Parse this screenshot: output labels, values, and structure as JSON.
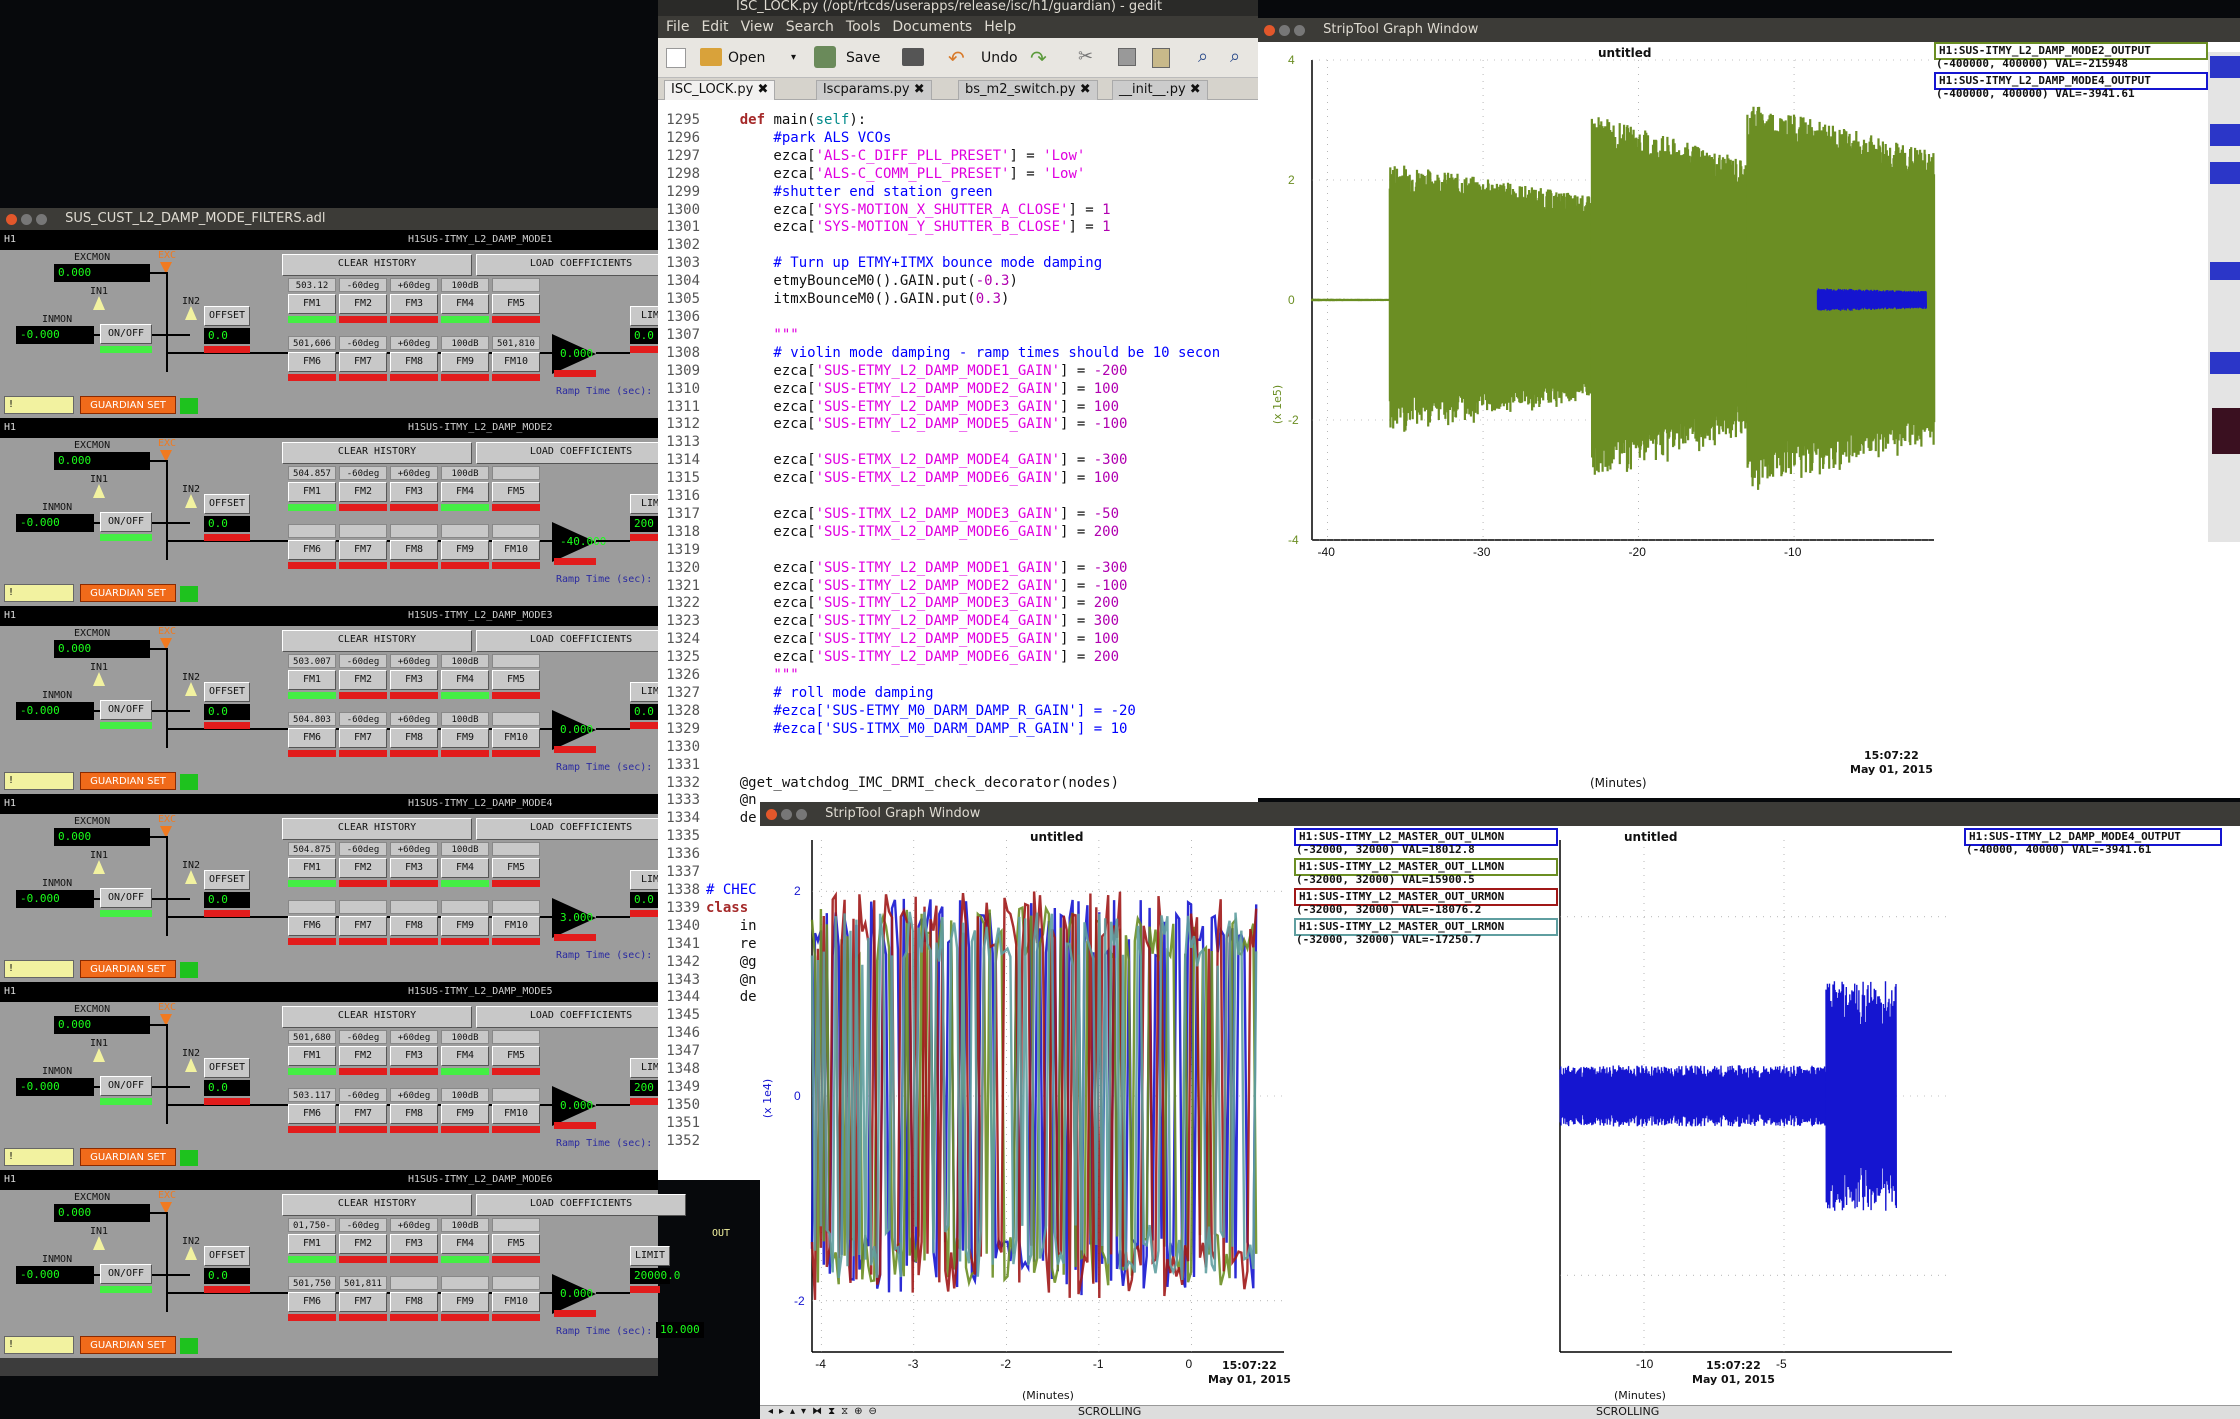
{
  "medm": {
    "title": "SUS_CUST_L2_DAMP_MODE_FILTERS.adl",
    "banks": [
      {
        "prefix": "H1",
        "name": "H1SUS-ITMY_L2_DAMP_MODE1",
        "excmon": "0.000",
        "inmon": "-0.000",
        "clear": "CLEAR HISTORY",
        "load": "LOAD COEFFICIENTS",
        "offset": "OFFSET",
        "offset_val": "0.0",
        "fm_top": [
          "FM1",
          "FM2",
          "FM3",
          "FM4",
          "FM5"
        ],
        "fm_bot": [
          "FM6",
          "FM7",
          "FM8",
          "FM9",
          "FM10"
        ],
        "vals_top": [
          "503.12",
          "-60deg",
          "+60deg",
          "100dB",
          ""
        ],
        "vals_bot": [
          "501,606",
          "-60deg",
          "+60deg",
          "100dB",
          "501,810"
        ],
        "out": "0.000",
        "limit_val": "0.0",
        "ramp": "Ramp Time (sec):",
        "onoff": "ON/OFF",
        "guardian": "GUARDIAN SET",
        "exc": "EXC",
        "in1": "IN1",
        "in2": "IN2",
        "limit": "LIM",
        "excmon_lbl": "EXCMON",
        "inmon_lbl": "INMON"
      },
      {
        "prefix": "H1",
        "name": "H1SUS-ITMY_L2_DAMP_MODE2",
        "excmon": "0.000",
        "inmon": "-0.000",
        "clear": "CLEAR HISTORY",
        "load": "LOAD COEFFICIENTS",
        "offset": "OFFSET",
        "offset_val": "0.0",
        "fm_top": [
          "FM1",
          "FM2",
          "FM3",
          "FM4",
          "FM5"
        ],
        "fm_bot": [
          "FM6",
          "FM7",
          "FM8",
          "FM9",
          "FM10"
        ],
        "vals_top": [
          "504.857",
          "-60deg",
          "+60deg",
          "100dB",
          ""
        ],
        "vals_bot": [
          "",
          "",
          "",
          "",
          ""
        ],
        "out": "-40.000",
        "limit_val": "200",
        "ramp": "Ramp Time (sec):",
        "onoff": "ON/OFF",
        "guardian": "GUARDIAN SET",
        "exc": "EXC",
        "in1": "IN1",
        "in2": "IN2",
        "limit": "LIM",
        "excmon_lbl": "EXCMON",
        "inmon_lbl": "INMON"
      },
      {
        "prefix": "H1",
        "name": "H1SUS-ITMY_L2_DAMP_MODE3",
        "excmon": "0.000",
        "inmon": "-0.000",
        "clear": "CLEAR HISTORY",
        "load": "LOAD COEFFICIENTS",
        "offset": "OFFSET",
        "offset_val": "0.0",
        "fm_top": [
          "FM1",
          "FM2",
          "FM3",
          "FM4",
          "FM5"
        ],
        "fm_bot": [
          "FM6",
          "FM7",
          "FM8",
          "FM9",
          "FM10"
        ],
        "vals_top": [
          "503.007",
          "-60deg",
          "+60deg",
          "100dB",
          ""
        ],
        "vals_bot": [
          "504.803",
          "-60deg",
          "+60deg",
          "100dB",
          ""
        ],
        "out": "0.000",
        "limit_val": "0.0",
        "ramp": "Ramp Time (sec):",
        "onoff": "ON/OFF",
        "guardian": "GUARDIAN SET",
        "exc": "EXC",
        "in1": "IN1",
        "in2": "IN2",
        "limit": "LIM",
        "excmon_lbl": "EXCMON",
        "inmon_lbl": "INMON"
      },
      {
        "prefix": "H1",
        "name": "H1SUS-ITMY_L2_DAMP_MODE4",
        "excmon": "0.000",
        "inmon": "-0.000",
        "clear": "CLEAR HISTORY",
        "load": "LOAD COEFFICIENTS",
        "offset": "OFFSET",
        "offset_val": "0.0",
        "fm_top": [
          "FM1",
          "FM2",
          "FM3",
          "FM4",
          "FM5"
        ],
        "fm_bot": [
          "FM6",
          "FM7",
          "FM8",
          "FM9",
          "FM10"
        ],
        "vals_top": [
          "504.875",
          "-60deg",
          "+60deg",
          "100dB",
          ""
        ],
        "vals_bot": [
          "",
          "",
          "",
          "",
          ""
        ],
        "out": "3.000",
        "limit_val": "0.0",
        "ramp": "Ramp Time (sec):",
        "onoff": "ON/OFF",
        "guardian": "GUARDIAN SET",
        "exc": "EXC",
        "in1": "IN1",
        "in2": "IN2",
        "limit": "LIM",
        "excmon_lbl": "EXCMON",
        "inmon_lbl": "INMON"
      },
      {
        "prefix": "H1",
        "name": "H1SUS-ITMY_L2_DAMP_MODE5",
        "excmon": "0.000",
        "inmon": "-0.000",
        "clear": "CLEAR HISTORY",
        "load": "LOAD COEFFICIENTS",
        "offset": "OFFSET",
        "offset_val": "0.0",
        "fm_top": [
          "FM1",
          "FM2",
          "FM3",
          "FM4",
          "FM5"
        ],
        "fm_bot": [
          "FM6",
          "FM7",
          "FM8",
          "FM9",
          "FM10"
        ],
        "vals_top": [
          "501,680",
          "-60deg",
          "+60deg",
          "100dB",
          ""
        ],
        "vals_bot": [
          "503.117",
          "-60deg",
          "+60deg",
          "100dB",
          ""
        ],
        "out": "0.000",
        "limit_val": "200",
        "ramp": "Ramp Time (sec):",
        "onoff": "ON/OFF",
        "guardian": "GUARDIAN SET",
        "exc": "EXC",
        "in1": "IN1",
        "in2": "IN2",
        "limit": "LIM",
        "excmon_lbl": "EXCMON",
        "inmon_lbl": "INMON"
      },
      {
        "prefix": "H1",
        "name": "H1SUS-ITMY_L2_DAMP_MODE6",
        "excmon": "0.000",
        "inmon": "-0.000",
        "clear": "CLEAR HISTORY",
        "load": "LOAD COEFFICIENTS",
        "offset": "OFFSET",
        "offset_val": "0.0",
        "fm_top": [
          "FM1",
          "FM2",
          "FM3",
          "FM4",
          "FM5"
        ],
        "fm_bot": [
          "FM6",
          "FM7",
          "FM8",
          "FM9",
          "FM10"
        ],
        "vals_top": [
          "01,750-84",
          "-60deg",
          "+60deg",
          "100dB",
          ""
        ],
        "vals_bot": [
          "501,750",
          "501,811",
          "",
          "",
          ""
        ],
        "out": "0.000",
        "limit_val": "20000.0",
        "ramp": "Ramp Time (sec):",
        "ramp_val": "10.000",
        "onoff": "ON/OFF",
        "guardian": "GUARDIAN SET",
        "exc": "EXC",
        "in1": "IN1",
        "in2": "IN2",
        "limit": "LIMIT",
        "out_lbl": "OUT",
        "excmon_lbl": "EXCMON",
        "inmon_lbl": "INMON"
      }
    ]
  },
  "gedit": {
    "title": "ISC_LOCK.py (/opt/rtcds/userapps/release/isc/h1/guardian) - gedit",
    "menu": [
      "File",
      "Edit",
      "View",
      "Search",
      "Tools",
      "Documents",
      "Help"
    ],
    "toolbar": {
      "open": "Open",
      "save": "Save",
      "undo": "Undo"
    },
    "tabs": [
      "ISC_LOCK.py",
      "lscparams.py",
      "bs_m2_switch.py",
      "__init__.py"
    ],
    "lines": [
      {
        "n": "1295",
        "t": "    def main(self):"
      },
      {
        "n": "1296",
        "t": "        #park ALS VCOs"
      },
      {
        "n": "1297",
        "t": "        ezca['ALS-C_DIFF_PLL_PRESET'] = 'Low'"
      },
      {
        "n": "1298",
        "t": "        ezca['ALS-C_COMM_PLL_PRESET'] = 'Low'"
      },
      {
        "n": "1299",
        "t": "        #shutter end station green"
      },
      {
        "n": "1300",
        "t": "        ezca['SYS-MOTION_X_SHUTTER_A_CLOSE'] = 1"
      },
      {
        "n": "1301",
        "t": "        ezca['SYS-MOTION_Y_SHUTTER_B_CLOSE'] = 1"
      },
      {
        "n": "1302",
        "t": ""
      },
      {
        "n": "1303",
        "t": "        # Turn up ETMY+ITMX bounce mode damping"
      },
      {
        "n": "1304",
        "t": "        etmyBounceM0().GAIN.put(-0.3)"
      },
      {
        "n": "1305",
        "t": "        itmxBounceM0().GAIN.put(0.3)"
      },
      {
        "n": "1306",
        "t": ""
      },
      {
        "n": "1307",
        "t": "        \"\"\""
      },
      {
        "n": "1308",
        "t": "        # violin mode damping - ramp times should be 10 secon"
      },
      {
        "n": "1309",
        "t": "        ezca['SUS-ETMY_L2_DAMP_MODE1_GAIN'] = -200"
      },
      {
        "n": "1310",
        "t": "        ezca['SUS-ETMY_L2_DAMP_MODE2_GAIN'] = 100"
      },
      {
        "n": "1311",
        "t": "        ezca['SUS-ETMY_L2_DAMP_MODE3_GAIN'] = 100"
      },
      {
        "n": "1312",
        "t": "        ezca['SUS-ETMY_L2_DAMP_MODE5_GAIN'] = -100"
      },
      {
        "n": "1313",
        "t": ""
      },
      {
        "n": "1314",
        "t": "        ezca['SUS-ETMX_L2_DAMP_MODE4_GAIN'] = -300"
      },
      {
        "n": "1315",
        "t": "        ezca['SUS-ETMX_L2_DAMP_MODE6_GAIN'] = 100"
      },
      {
        "n": "1316",
        "t": ""
      },
      {
        "n": "1317",
        "t": "        ezca['SUS-ITMX_L2_DAMP_MODE3_GAIN'] = -50"
      },
      {
        "n": "1318",
        "t": "        ezca['SUS-ITMX_L2_DAMP_MODE6_GAIN'] = 200"
      },
      {
        "n": "1319",
        "t": ""
      },
      {
        "n": "1320",
        "t": "        ezca['SUS-ITMY_L2_DAMP_MODE1_GAIN'] = -300"
      },
      {
        "n": "1321",
        "t": "        ezca['SUS-ITMY_L2_DAMP_MODE2_GAIN'] = -100"
      },
      {
        "n": "1322",
        "t": "        ezca['SUS-ITMY_L2_DAMP_MODE3_GAIN'] = 200"
      },
      {
        "n": "1323",
        "t": "        ezca['SUS-ITMY_L2_DAMP_MODE4_GAIN'] = 300"
      },
      {
        "n": "1324",
        "t": "        ezca['SUS-ITMY_L2_DAMP_MODE5_GAIN'] = 100"
      },
      {
        "n": "1325",
        "t": "        ezca['SUS-ITMY_L2_DAMP_MODE6_GAIN'] = 200"
      },
      {
        "n": "1326",
        "t": "        \"\"\""
      },
      {
        "n": "1327",
        "t": "        # roll mode damping"
      },
      {
        "n": "1328",
        "t": "        #ezca['SUS-ETMY_M0_DARM_DAMP_R_GAIN'] = -20"
      },
      {
        "n": "1329",
        "t": "        #ezca['SUS-ITMX_M0_DARM_DAMP_R_GAIN'] = 10"
      },
      {
        "n": "1330",
        "t": ""
      },
      {
        "n": "1331",
        "t": ""
      },
      {
        "n": "1332",
        "t": "    @get_watchdog_IMC_DRMI_check_decorator(nodes)"
      },
      {
        "n": "1333",
        "t": "    @n"
      },
      {
        "n": "1334",
        "t": "    de"
      },
      {
        "n": "1335",
        "t": ""
      },
      {
        "n": "1336",
        "t": ""
      },
      {
        "n": "1337",
        "t": ""
      },
      {
        "n": "1338",
        "t": "# CHEC"
      },
      {
        "n": "1339",
        "t": "class"
      },
      {
        "n": "1340",
        "t": "    in"
      },
      {
        "n": "1341",
        "t": "    re"
      },
      {
        "n": "1342",
        "t": "    @g"
      },
      {
        "n": "1343",
        "t": "    @n"
      },
      {
        "n": "1344",
        "t": "    de"
      },
      {
        "n": "1345",
        "t": ""
      },
      {
        "n": "1346",
        "t": ""
      },
      {
        "n": "1347",
        "t": ""
      },
      {
        "n": "1348",
        "t": ""
      },
      {
        "n": "1349",
        "t": ""
      },
      {
        "n": "1350",
        "t": ""
      },
      {
        "n": "1351",
        "t": ""
      },
      {
        "n": "1352",
        "t": ""
      }
    ]
  },
  "striptool1": {
    "window_title": "StripTool Graph Window",
    "plot_title": "untitled",
    "y_unit": "(x 1e5)",
    "xlabel": "(Minutes)",
    "time": "15:07:22",
    "date": "May 01, 2015",
    "legend": [
      {
        "name": "H1:SUS-ITMY_L2_DAMP_MODE2_OUTPUT",
        "range": "(-400000, 400000) VAL=-215948",
        "color": "#6b8e23"
      },
      {
        "name": "H1:SUS-ITMY_L2_DAMP_MODE4_OUTPUT",
        "range": "(-400000, 400000) VAL=-3941.61",
        "color": "#1515d0"
      }
    ]
  },
  "striptool2": {
    "window_title": "StripTool Graph Window",
    "left_title": "untitled",
    "right_title": "untitled",
    "y_unit": "(x 1e4)",
    "xlabel": "(Minutes)",
    "time": "15:07:22",
    "date": "May 01, 2015",
    "status": "SCROLLING",
    "legend_left": [
      {
        "name": "H1:SUS-ITMY_L2_MASTER_OUT_ULMON",
        "range": "(-32000, 32000) VAL=18012.8",
        "color": "#1515d0"
      },
      {
        "name": "H1:SUS-ITMY_L2_MASTER_OUT_LLMON",
        "range": "(-32000, 32000) VAL=15900.5",
        "color": "#6b8e23"
      },
      {
        "name": "H1:SUS-ITMY_L2_MASTER_OUT_URMON",
        "range": "(-32000, 32000) VAL=-18076.2",
        "color": "#a01818"
      },
      {
        "name": "H1:SUS-ITMY_L2_MASTER_OUT_LRMON",
        "range": "(-32000, 32000) VAL=-17250.7",
        "color": "#5f9ea0"
      }
    ],
    "legend_right": [
      {
        "name": "H1:SUS-ITMY_L2_DAMP_MODE4_OUTPUT",
        "range": "(-40000, 40000) VAL=-3941.61",
        "color": "#1515d0"
      }
    ]
  },
  "chart_data": [
    {
      "type": "line",
      "title": "untitled",
      "xlabel": "(Minutes)",
      "ylabel": "(x 1e5)",
      "xlim": [
        -41,
        -1
      ],
      "ylim": [
        -4,
        4
      ],
      "x_ticks": [
        -40,
        -30,
        -20,
        -10
      ],
      "y_ticks": [
        4,
        2,
        0,
        -2,
        -4
      ],
      "series": [
        {
          "name": "H1:SUS-ITMY_L2_DAMP_MODE2_OUTPUT",
          "color": "#6b8e23",
          "segments": [
            {
              "x": [
                -41,
                -36
              ],
              "amp": 0.02
            },
            {
              "x": [
                -36,
                -23
              ],
              "amp": 2.3
            },
            {
              "x": [
                -23,
                -13
              ],
              "amp": 3.1
            },
            {
              "x": [
                -13,
                -1
              ],
              "amp": 3.3
            }
          ]
        },
        {
          "name": "H1:SUS-ITMY_L2_DAMP_MODE4_OUTPUT",
          "color": "#1515d0",
          "segments": [
            {
              "x": [
                -8.5,
                -1.5
              ],
              "amp": 0.2
            }
          ]
        }
      ]
    },
    {
      "type": "line",
      "title": "untitled",
      "xlabel": "(Minutes)",
      "ylabel": "(x 1e4)",
      "xlim": [
        -4.1,
        1
      ],
      "ylim": [
        -2.5,
        2.5
      ],
      "x_ticks": [
        -4,
        -3,
        -2,
        -1,
        0
      ],
      "y_ticks": [
        2,
        0,
        -2
      ],
      "series": [
        {
          "name": "H1:SUS-ITMY_L2_MASTER_OUT_ULMON",
          "color": "#1515d0",
          "amp": 1.95
        },
        {
          "name": "H1:SUS-ITMY_L2_MASTER_OUT_LLMON",
          "color": "#6b8e23",
          "amp": 1.85
        },
        {
          "name": "H1:SUS-ITMY_L2_MASTER_OUT_URMON",
          "color": "#a01818",
          "amp": 2.0
        },
        {
          "name": "H1:SUS-ITMY_L2_MASTER_OUT_LRMON",
          "color": "#5f9ea0",
          "amp": 1.8
        }
      ]
    },
    {
      "type": "line",
      "title": "untitled",
      "xlabel": "(Minutes)",
      "ylabel": "",
      "xlim": [
        -13,
        1
      ],
      "ylim": [
        -1,
        1
      ],
      "x_ticks": [
        -10,
        -5
      ],
      "series": [
        {
          "name": "H1:SUS-ITMY_L2_DAMP_MODE4_OUTPUT",
          "color": "#1515d0",
          "segments": [
            {
              "x": [
                -13,
                -3.5
              ],
              "amp": 0.12
            },
            {
              "x": [
                -3.5,
                -1
              ],
              "amp": 0.45
            }
          ]
        }
      ]
    }
  ]
}
